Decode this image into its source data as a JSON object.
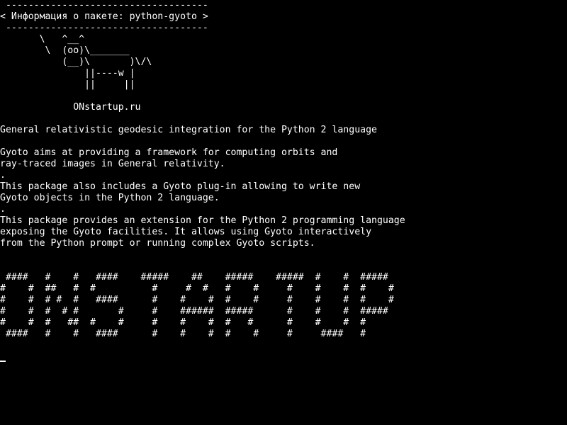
{
  "terminal": {
    "lines": [
      " ------------------------------------",
      "< Информация о пакете: python-gyoto >",
      " ------------------------------------",
      "       \\   ^__^",
      "        \\  (oo)\\_______",
      "           (__)\\       )\\/\\",
      "               ||----w |",
      "               ||     ||",
      "",
      "             ONstartup.ru",
      "",
      "General relativistic geodesic integration for the Python 2 language",
      "",
      "Gyoto aims at providing a framework for computing orbits and",
      "ray-traced images in General relativity.",
      ".",
      "This package also includes a Gyoto plug-in allowing to write new",
      "Gyoto objects in the Python 2 language.",
      ".",
      "This package provides an extension for the Python 2 programming language",
      "exposing the Gyoto facilities. It allows using Gyoto interactively",
      "from the Python prompt or running complex Gyoto scripts.",
      "",
      "",
      " ####   #    #   ####    #####    ##    #####    #####  #    #  #####",
      "#    #  ##   #  #          #     #  #   #    #     #    #    #  #    #",
      "#    #  # #  #   ####      #    #    #  #    #     #    #    #  #    #",
      "#    #  #  # #       #     #    ######  #####      #    #    #  #####",
      "#    #  #   ##  #    #     #    #    #  #   #      #    #    #  #",
      " ####   #    #   ####      #    #    #  #    #     #     ####   #"
    ]
  }
}
